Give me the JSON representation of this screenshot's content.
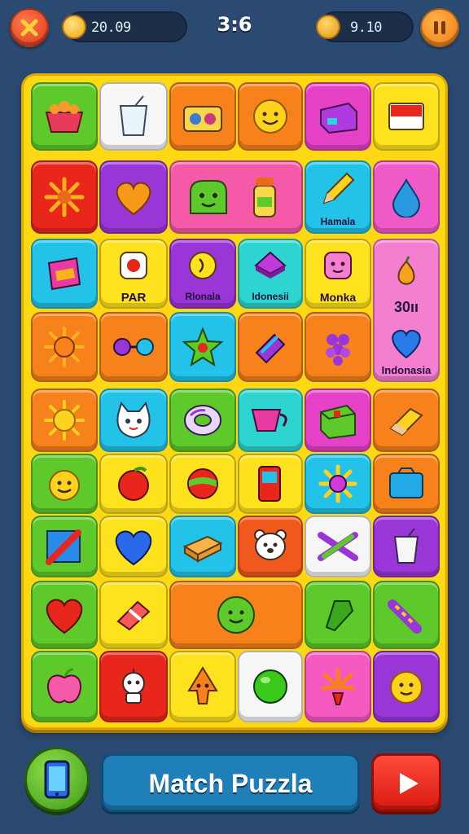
{
  "hud": {
    "left_counter": "20.09",
    "timer": "3:6",
    "right_counter": "9.10"
  },
  "board": {
    "labels": {
      "r1c6": "Hamala",
      "r2c2": "PAR",
      "r2c3": "Rlonala",
      "r2c4": "Idonesii",
      "r2c5": "Monka",
      "r2c6_top": "30ıı",
      "r2c6_bottom": "Indonasia"
    }
  },
  "footer": {
    "title": "Match Puzzla"
  },
  "colors": {
    "background": "#2b4a72",
    "board": "#ffd814",
    "accent_title": "#1f7fb8"
  }
}
